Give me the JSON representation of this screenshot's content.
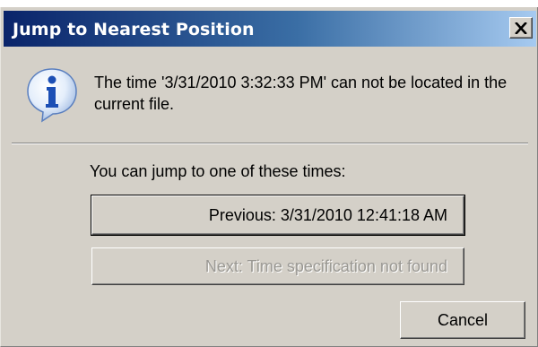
{
  "dialog": {
    "title": "Jump to Nearest Position",
    "close_label": "X",
    "message": "The time '3/31/2010 3:32:33 PM' can not be located in the current file.",
    "prompt": "You can jump to one of these times:",
    "previous_button": "Previous: 3/31/2010 12:41:18 AM",
    "next_button": "Next: Time specification not found",
    "cancel_button": "Cancel",
    "icon": "info-icon"
  },
  "colors": {
    "title_gradient_start": "#0a246a",
    "title_gradient_end": "#a6caf0",
    "dialog_face": "#d4d0c8",
    "disabled_text": "#9a9893"
  }
}
